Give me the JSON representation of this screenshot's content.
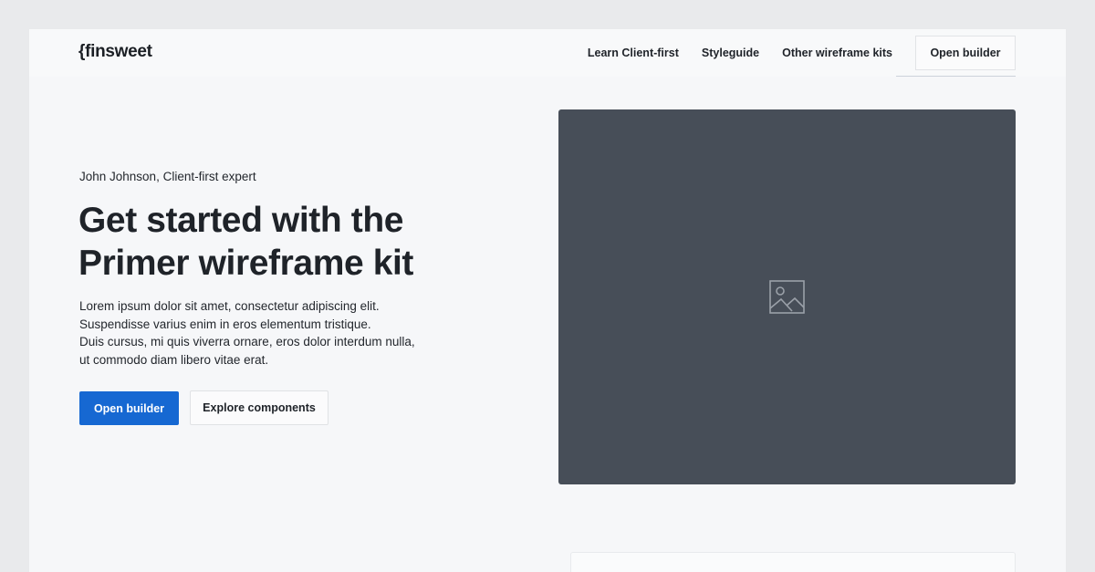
{
  "brand": {
    "logo_text": "{finsweet"
  },
  "nav": {
    "links": [
      "Learn Client-first",
      "Styleguide",
      "Other wireframe kits"
    ],
    "cta_label": "Open builder"
  },
  "hero": {
    "eyebrow": "John Johnson, Client-first expert",
    "headline_line1": "Get started with the",
    "headline_line2": "Primer wireframe kit",
    "body_lines": [
      "Lorem ipsum dolor sit amet, consectetur adipiscing elit.",
      "Suspendisse varius enim in eros elementum tristique.",
      "Duis cursus, mi quis viverra ornare, eros dolor interdum nulla,",
      "ut commodo diam libero vitae erat."
    ],
    "primary_button": "Open builder",
    "secondary_button": "Explore components",
    "image_icon": "image-placeholder-icon"
  },
  "colors": {
    "primary": "#1668d2",
    "image_bg": "#474e58",
    "page_bg": "#f6f7f9",
    "outer_bg": "#e9eaec"
  }
}
